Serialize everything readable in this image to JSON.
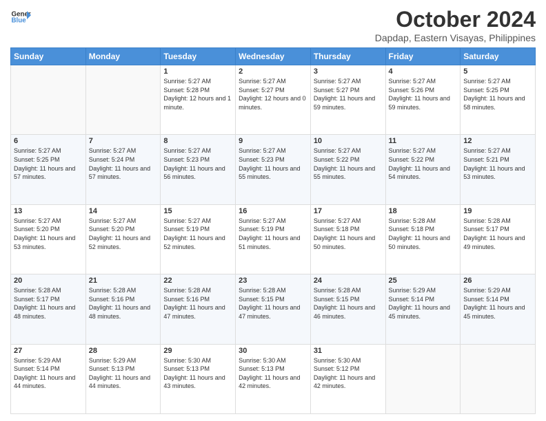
{
  "logo": {
    "line1": "General",
    "line2": "Blue"
  },
  "header": {
    "title": "October 2024",
    "subtitle": "Dapdap, Eastern Visayas, Philippines"
  },
  "weekdays": [
    "Sunday",
    "Monday",
    "Tuesday",
    "Wednesday",
    "Thursday",
    "Friday",
    "Saturday"
  ],
  "weeks": [
    [
      {
        "day": "",
        "sunrise": "",
        "sunset": "",
        "daylight": ""
      },
      {
        "day": "",
        "sunrise": "",
        "sunset": "",
        "daylight": ""
      },
      {
        "day": "1",
        "sunrise": "Sunrise: 5:27 AM",
        "sunset": "Sunset: 5:28 PM",
        "daylight": "Daylight: 12 hours and 1 minute."
      },
      {
        "day": "2",
        "sunrise": "Sunrise: 5:27 AM",
        "sunset": "Sunset: 5:27 PM",
        "daylight": "Daylight: 12 hours and 0 minutes."
      },
      {
        "day": "3",
        "sunrise": "Sunrise: 5:27 AM",
        "sunset": "Sunset: 5:27 PM",
        "daylight": "Daylight: 11 hours and 59 minutes."
      },
      {
        "day": "4",
        "sunrise": "Sunrise: 5:27 AM",
        "sunset": "Sunset: 5:26 PM",
        "daylight": "Daylight: 11 hours and 59 minutes."
      },
      {
        "day": "5",
        "sunrise": "Sunrise: 5:27 AM",
        "sunset": "Sunset: 5:25 PM",
        "daylight": "Daylight: 11 hours and 58 minutes."
      }
    ],
    [
      {
        "day": "6",
        "sunrise": "Sunrise: 5:27 AM",
        "sunset": "Sunset: 5:25 PM",
        "daylight": "Daylight: 11 hours and 57 minutes."
      },
      {
        "day": "7",
        "sunrise": "Sunrise: 5:27 AM",
        "sunset": "Sunset: 5:24 PM",
        "daylight": "Daylight: 11 hours and 57 minutes."
      },
      {
        "day": "8",
        "sunrise": "Sunrise: 5:27 AM",
        "sunset": "Sunset: 5:23 PM",
        "daylight": "Daylight: 11 hours and 56 minutes."
      },
      {
        "day": "9",
        "sunrise": "Sunrise: 5:27 AM",
        "sunset": "Sunset: 5:23 PM",
        "daylight": "Daylight: 11 hours and 55 minutes."
      },
      {
        "day": "10",
        "sunrise": "Sunrise: 5:27 AM",
        "sunset": "Sunset: 5:22 PM",
        "daylight": "Daylight: 11 hours and 55 minutes."
      },
      {
        "day": "11",
        "sunrise": "Sunrise: 5:27 AM",
        "sunset": "Sunset: 5:22 PM",
        "daylight": "Daylight: 11 hours and 54 minutes."
      },
      {
        "day": "12",
        "sunrise": "Sunrise: 5:27 AM",
        "sunset": "Sunset: 5:21 PM",
        "daylight": "Daylight: 11 hours and 53 minutes."
      }
    ],
    [
      {
        "day": "13",
        "sunrise": "Sunrise: 5:27 AM",
        "sunset": "Sunset: 5:20 PM",
        "daylight": "Daylight: 11 hours and 53 minutes."
      },
      {
        "day": "14",
        "sunrise": "Sunrise: 5:27 AM",
        "sunset": "Sunset: 5:20 PM",
        "daylight": "Daylight: 11 hours and 52 minutes."
      },
      {
        "day": "15",
        "sunrise": "Sunrise: 5:27 AM",
        "sunset": "Sunset: 5:19 PM",
        "daylight": "Daylight: 11 hours and 52 minutes."
      },
      {
        "day": "16",
        "sunrise": "Sunrise: 5:27 AM",
        "sunset": "Sunset: 5:19 PM",
        "daylight": "Daylight: 11 hours and 51 minutes."
      },
      {
        "day": "17",
        "sunrise": "Sunrise: 5:27 AM",
        "sunset": "Sunset: 5:18 PM",
        "daylight": "Daylight: 11 hours and 50 minutes."
      },
      {
        "day": "18",
        "sunrise": "Sunrise: 5:28 AM",
        "sunset": "Sunset: 5:18 PM",
        "daylight": "Daylight: 11 hours and 50 minutes."
      },
      {
        "day": "19",
        "sunrise": "Sunrise: 5:28 AM",
        "sunset": "Sunset: 5:17 PM",
        "daylight": "Daylight: 11 hours and 49 minutes."
      }
    ],
    [
      {
        "day": "20",
        "sunrise": "Sunrise: 5:28 AM",
        "sunset": "Sunset: 5:17 PM",
        "daylight": "Daylight: 11 hours and 48 minutes."
      },
      {
        "day": "21",
        "sunrise": "Sunrise: 5:28 AM",
        "sunset": "Sunset: 5:16 PM",
        "daylight": "Daylight: 11 hours and 48 minutes."
      },
      {
        "day": "22",
        "sunrise": "Sunrise: 5:28 AM",
        "sunset": "Sunset: 5:16 PM",
        "daylight": "Daylight: 11 hours and 47 minutes."
      },
      {
        "day": "23",
        "sunrise": "Sunrise: 5:28 AM",
        "sunset": "Sunset: 5:15 PM",
        "daylight": "Daylight: 11 hours and 47 minutes."
      },
      {
        "day": "24",
        "sunrise": "Sunrise: 5:28 AM",
        "sunset": "Sunset: 5:15 PM",
        "daylight": "Daylight: 11 hours and 46 minutes."
      },
      {
        "day": "25",
        "sunrise": "Sunrise: 5:29 AM",
        "sunset": "Sunset: 5:14 PM",
        "daylight": "Daylight: 11 hours and 45 minutes."
      },
      {
        "day": "26",
        "sunrise": "Sunrise: 5:29 AM",
        "sunset": "Sunset: 5:14 PM",
        "daylight": "Daylight: 11 hours and 45 minutes."
      }
    ],
    [
      {
        "day": "27",
        "sunrise": "Sunrise: 5:29 AM",
        "sunset": "Sunset: 5:14 PM",
        "daylight": "Daylight: 11 hours and 44 minutes."
      },
      {
        "day": "28",
        "sunrise": "Sunrise: 5:29 AM",
        "sunset": "Sunset: 5:13 PM",
        "daylight": "Daylight: 11 hours and 44 minutes."
      },
      {
        "day": "29",
        "sunrise": "Sunrise: 5:30 AM",
        "sunset": "Sunset: 5:13 PM",
        "daylight": "Daylight: 11 hours and 43 minutes."
      },
      {
        "day": "30",
        "sunrise": "Sunrise: 5:30 AM",
        "sunset": "Sunset: 5:13 PM",
        "daylight": "Daylight: 11 hours and 42 minutes."
      },
      {
        "day": "31",
        "sunrise": "Sunrise: 5:30 AM",
        "sunset": "Sunset: 5:12 PM",
        "daylight": "Daylight: 11 hours and 42 minutes."
      },
      {
        "day": "",
        "sunrise": "",
        "sunset": "",
        "daylight": ""
      },
      {
        "day": "",
        "sunrise": "",
        "sunset": "",
        "daylight": ""
      }
    ]
  ]
}
